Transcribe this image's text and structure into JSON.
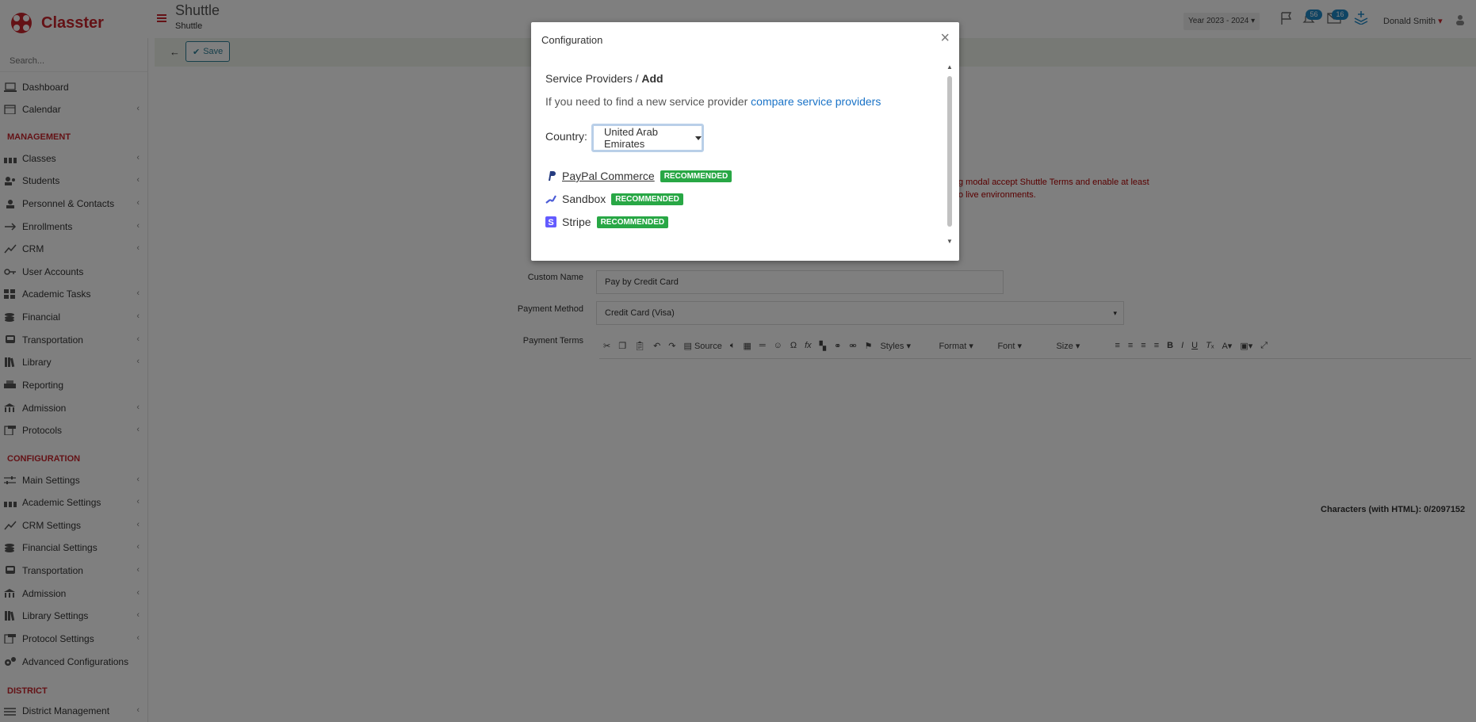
{
  "app": {
    "name": "Classter",
    "title": "Shuttle",
    "subtitle": "Shuttle"
  },
  "search": {
    "placeholder": "Search..."
  },
  "sidebar": {
    "items_top": [
      {
        "label": "Dashboard",
        "icon": "laptop-icon",
        "chev": false
      },
      {
        "label": "Calendar",
        "icon": "calendar-icon",
        "chev": true
      }
    ],
    "section_management": "MANAGEMENT",
    "items_management": [
      {
        "label": "Classes",
        "icon": "classes-icon",
        "chev": true
      },
      {
        "label": "Students",
        "icon": "students-icon",
        "chev": true
      },
      {
        "label": "Personnel & Contacts",
        "icon": "personnel-icon",
        "chev": true
      },
      {
        "label": "Enrollments",
        "icon": "enrollments-icon",
        "chev": true
      },
      {
        "label": "CRM",
        "icon": "crm-icon",
        "chev": true
      },
      {
        "label": "User Accounts",
        "icon": "key-icon",
        "chev": false
      },
      {
        "label": "Academic Tasks",
        "icon": "grid-icon",
        "chev": true
      },
      {
        "label": "Financial",
        "icon": "coins-icon",
        "chev": true
      },
      {
        "label": "Transportation",
        "icon": "bus-icon",
        "chev": true
      },
      {
        "label": "Library",
        "icon": "books-icon",
        "chev": true
      },
      {
        "label": "Reporting",
        "icon": "print-icon",
        "chev": false
      },
      {
        "label": "Admission",
        "icon": "building-icon",
        "chev": true
      },
      {
        "label": "Protocols",
        "icon": "protocols-icon",
        "chev": true
      }
    ],
    "section_configuration": "CONFIGURATION",
    "items_configuration": [
      {
        "label": "Main Settings",
        "icon": "sliders-icon",
        "chev": true
      },
      {
        "label": "Academic Settings",
        "icon": "classes-icon",
        "chev": true
      },
      {
        "label": "CRM Settings",
        "icon": "crm-icon",
        "chev": true
      },
      {
        "label": "Financial Settings",
        "icon": "coins-icon",
        "chev": true
      },
      {
        "label": "Transportation",
        "icon": "bus-icon",
        "chev": true
      },
      {
        "label": "Admission",
        "icon": "building-icon",
        "chev": true
      },
      {
        "label": "Library Settings",
        "icon": "books-icon",
        "chev": true
      },
      {
        "label": "Protocol Settings",
        "icon": "protocols-icon",
        "chev": true
      },
      {
        "label": "Advanced Configurations",
        "icon": "gears-icon",
        "chev": false
      }
    ],
    "section_district": "DISTRICT",
    "items_district": [
      {
        "label": "District Management",
        "icon": "district-icon",
        "chev": true
      }
    ]
  },
  "header": {
    "year": "Year 2023 - 2024",
    "notifications_count": "56",
    "messages_count": "16",
    "user": "Donald Smith"
  },
  "toolbar": {
    "save_label": "Save"
  },
  "form": {
    "error_line1": "g modal accept Shuttle Terms and enable at least",
    "error_line2": "o live environments.",
    "custom_name_label": "Custom Name",
    "custom_name_value": "Pay by Credit Card",
    "payment_method_label": "Payment Method",
    "payment_method_value": "Credit Card (Visa)",
    "payment_terms_label": "Payment Terms",
    "editor": {
      "source": "Source",
      "styles": "Styles",
      "format": "Format",
      "font": "Font",
      "size": "Size"
    },
    "chars": "Characters (with HTML): 0/2097152"
  },
  "modal": {
    "title": "Configuration",
    "crumb_parent": "Service Providers",
    "crumb_sep": "/",
    "crumb_current": "Add",
    "hint_text": "If you need to find a new service provider",
    "hint_link": "compare service providers",
    "country_label": "Country:",
    "country_value": "United Arab Emirates",
    "providers": [
      {
        "name": "PayPal Commerce",
        "badge": "RECOMMENDED",
        "icon": "paypal-icon",
        "color": "#253b80"
      },
      {
        "name": "Sandbox",
        "badge": "RECOMMENDED",
        "icon": "sandbox-icon",
        "color": "#4a5bd6"
      },
      {
        "name": "Stripe",
        "badge": "RECOMMENDED",
        "icon": "stripe-icon",
        "color": "#635bff"
      }
    ]
  }
}
